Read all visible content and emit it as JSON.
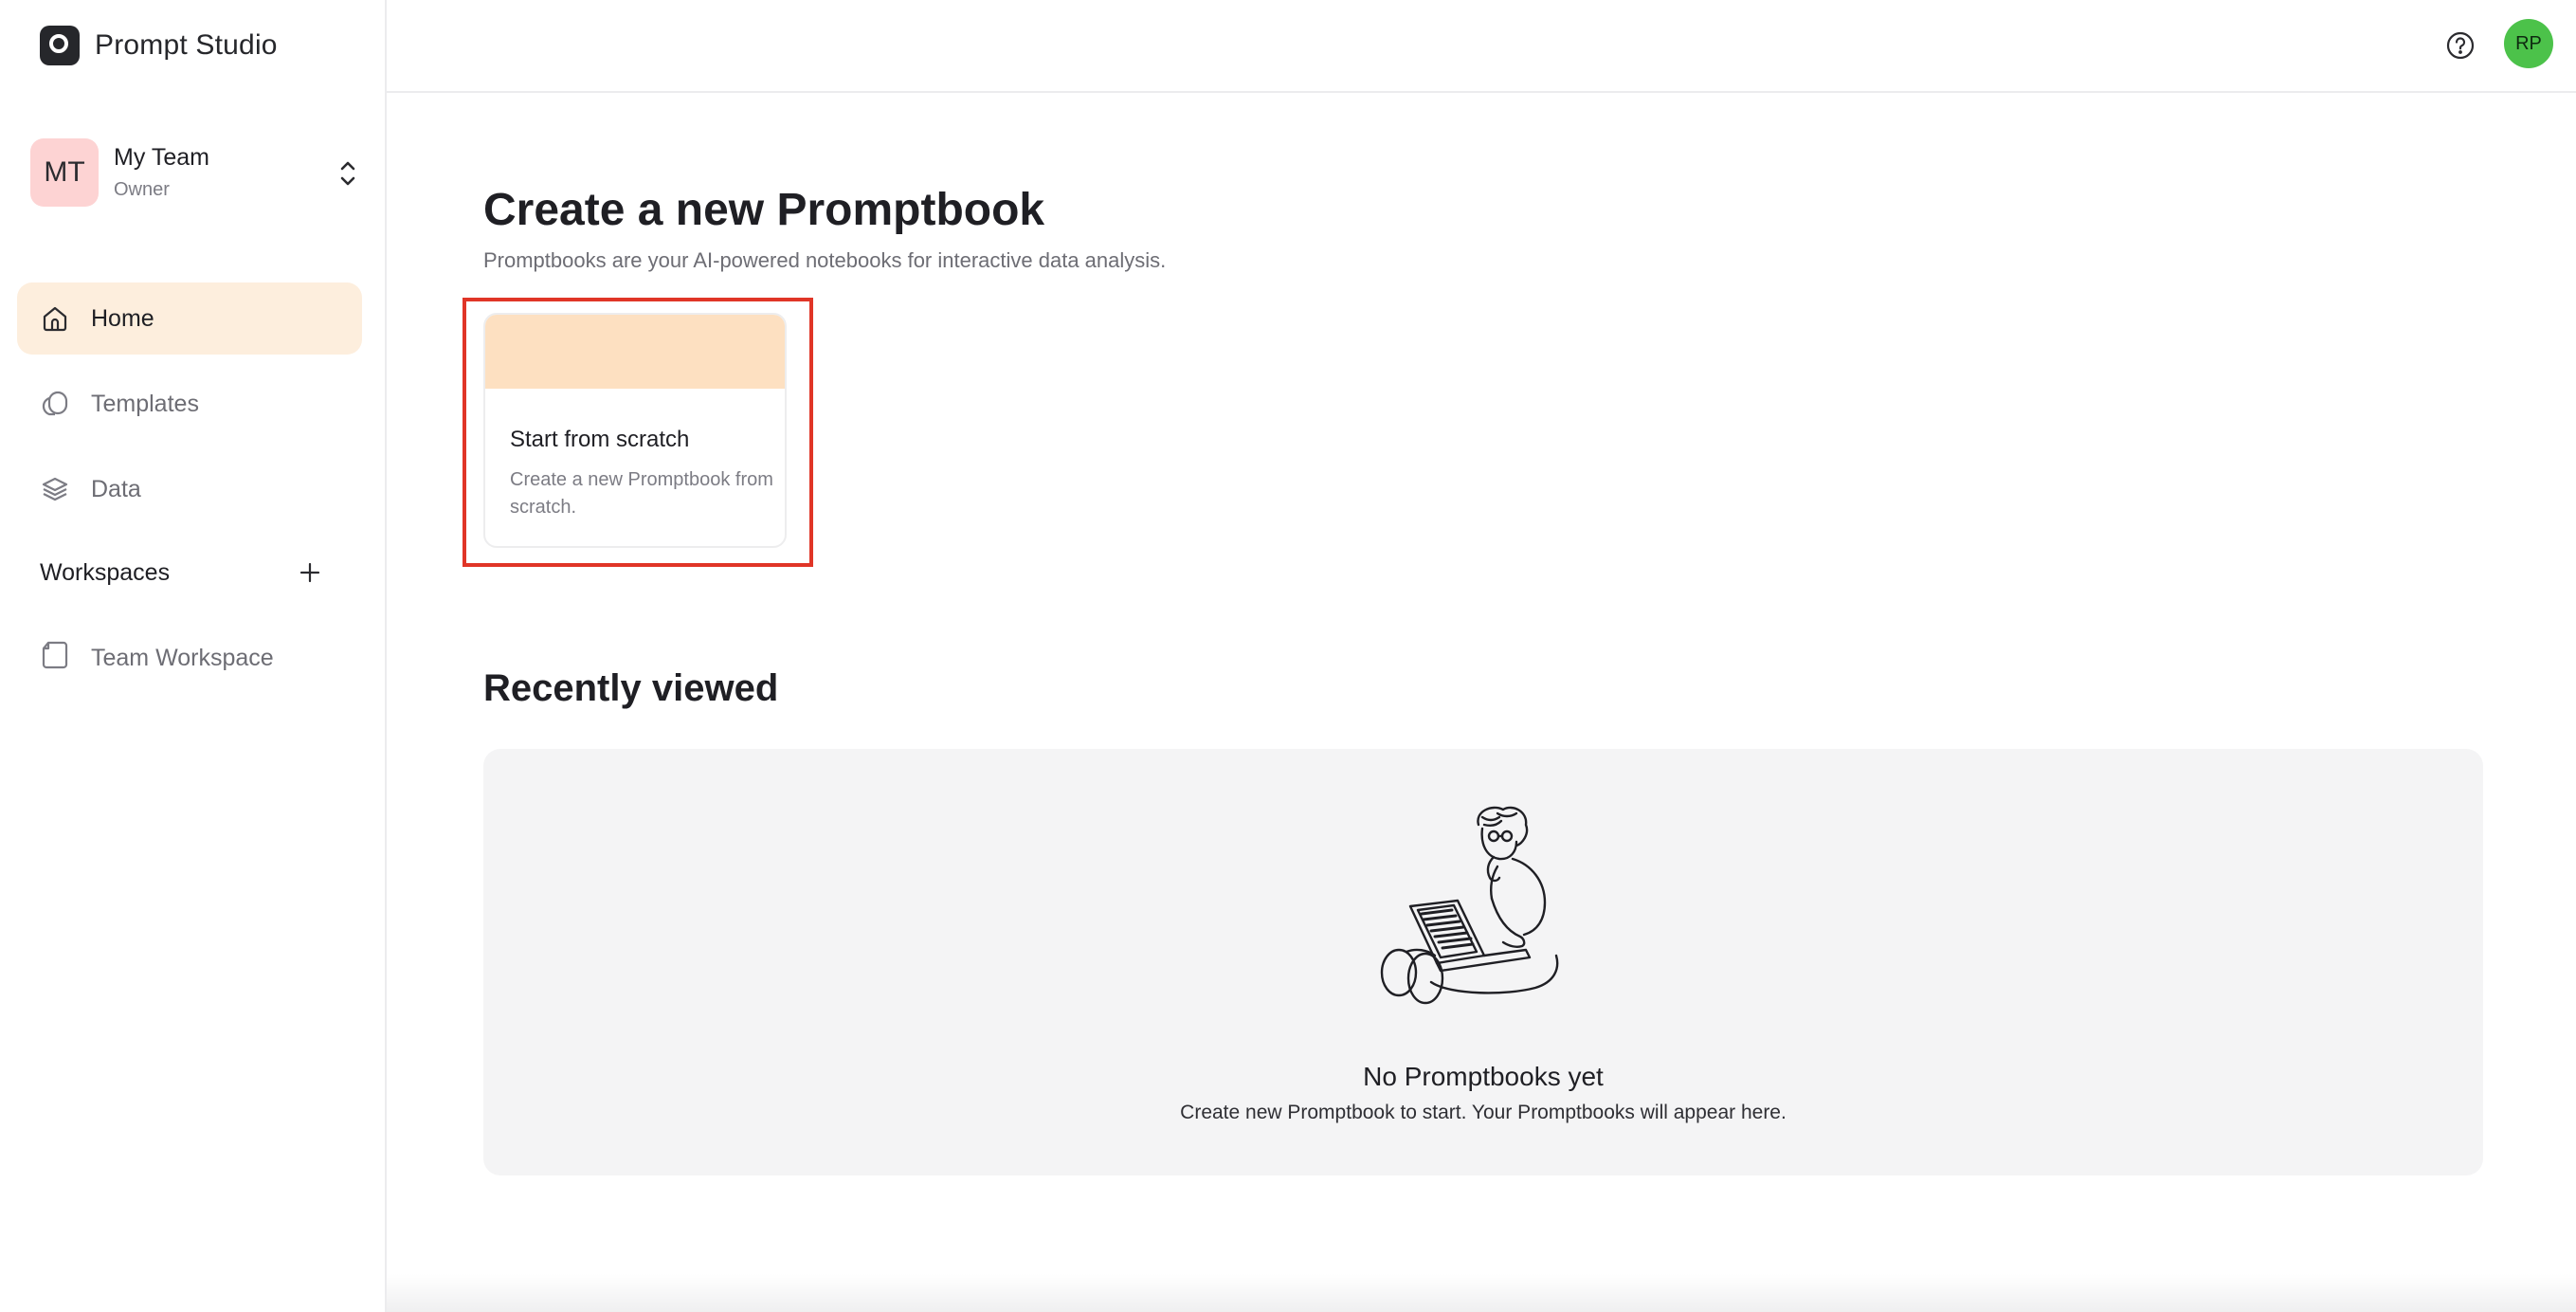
{
  "app": {
    "name": "Prompt Studio"
  },
  "team": {
    "initials": "MT",
    "name": "My Team",
    "role": "Owner"
  },
  "nav": {
    "items": [
      {
        "label": "Home",
        "icon": "home-icon",
        "active": true
      },
      {
        "label": "Templates",
        "icon": "templates-icon",
        "active": false
      },
      {
        "label": "Data",
        "icon": "layers-icon",
        "active": false
      }
    ]
  },
  "workspaces": {
    "title": "Workspaces",
    "items": [
      {
        "label": "Team Workspace",
        "icon": "workspace-icon"
      }
    ]
  },
  "topbar": {
    "user_initials": "RP",
    "help_icon": "help-circle-icon"
  },
  "main": {
    "title": "Create a new Promptbook",
    "subtitle": "Promptbooks are your AI-powered notebooks for interactive data analysis.",
    "card": {
      "title": "Start from scratch",
      "description": "Create a new Promptbook from scratch."
    },
    "recent": {
      "title": "Recently viewed",
      "empty_title": "No Promptbooks yet",
      "empty_subtitle": "Create new Promptbook to start. Your Promptbooks will appear here."
    }
  },
  "colors": {
    "accent_active_bg": "#fdeedd",
    "card_banner": "#fde0c1",
    "team_avatar_bg": "#fdd3d3",
    "user_avatar_bg": "#4cc24a",
    "highlight_border": "#e03527"
  }
}
